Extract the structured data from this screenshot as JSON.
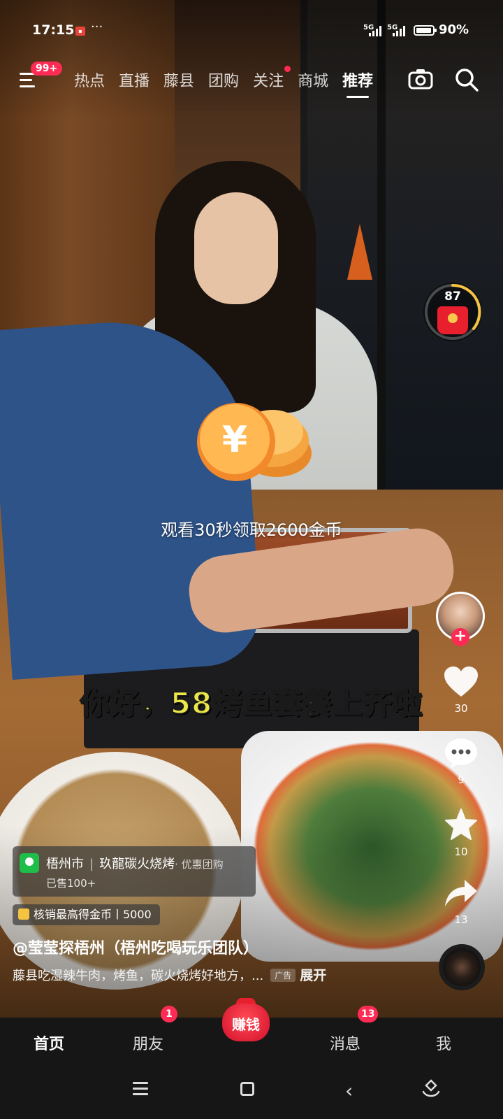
{
  "status_bar": {
    "time": "17:15",
    "net1": "5G",
    "net2": "5G",
    "battery": "90%"
  },
  "top_nav": {
    "menu_badge": "99+",
    "tabs": [
      {
        "label": "热点",
        "active": false
      },
      {
        "label": "直播",
        "active": false
      },
      {
        "label": "藤县",
        "active": false
      },
      {
        "label": "团购",
        "active": false
      },
      {
        "label": "关注",
        "active": false,
        "dot": true
      },
      {
        "label": "商城",
        "active": false
      },
      {
        "label": "推荐",
        "active": true
      }
    ]
  },
  "red_packet": {
    "count": "87"
  },
  "coin_prompt": {
    "text": "观看30秒领取2600金币"
  },
  "subtitle": "你好，58烤鱼套餐上齐啦",
  "rail": {
    "likes": "30",
    "comments": "9",
    "favorites": "10",
    "shares": "13"
  },
  "poi": {
    "city": "梧州市",
    "shop": "玖龍碳火烧烤",
    "tag": "· 优惠团购",
    "sold": "已售100+"
  },
  "coin_reward": "核销最高得金币丨5000",
  "author": "@莹莹探梧州（梧州吃喝玩乐团队）",
  "description": "藤县吃湿辣牛肉，烤鱼，碳火烧烤好地方，...",
  "ad_tag": "广告",
  "expand_label": "展开",
  "tab_bar": {
    "home": "首页",
    "friends": "朋友",
    "friends_badge": "1",
    "earn": "赚钱",
    "messages": "消息",
    "messages_badge": "13",
    "me": "我"
  },
  "colors": {
    "accent": "#fe2c55",
    "subtitle": "#ece64a",
    "coin": "#f5a63a"
  }
}
